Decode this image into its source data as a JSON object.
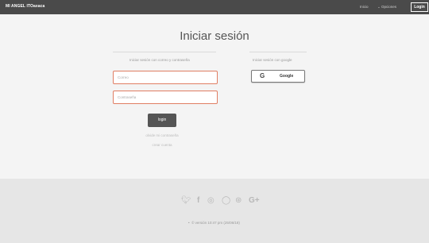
{
  "nav": {
    "brand": "MI ANGEL ITOaxaca",
    "inicio": "Inicio",
    "opciones": "Opciones",
    "login": "Login"
  },
  "page": {
    "title": "Iniciar sesión",
    "email_section": "Iniciar sesión con correo y contraseña",
    "google_section": "Iniciar sesión con google",
    "email_placeholder": "Correo",
    "password_placeholder": "Contraseña",
    "google_button": "Google",
    "submit": "login",
    "forgot": "olvide mi contraseña",
    "create": "crear cuenta"
  },
  "footer": {
    "social_icons": [
      "twitter-icon",
      "facebook-icon",
      "instagram-icon",
      "github-icon",
      "dribbble-icon",
      "google-plus-icon"
    ],
    "version": "© versión 10:47 pm (25/06/18)"
  }
}
